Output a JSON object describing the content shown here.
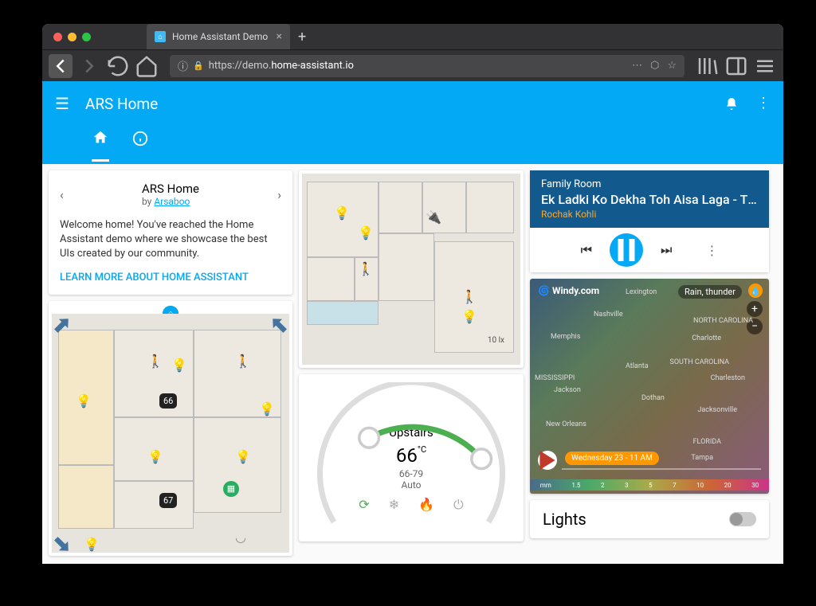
{
  "browser": {
    "tab_title": "Home Assistant Demo",
    "url_prefix": "https://",
    "url_sub": "demo.",
    "url_host": "home-assistant.io"
  },
  "header": {
    "title": "ARS Home"
  },
  "welcome": {
    "title": "ARS Home",
    "by": "by ",
    "author": "Arsaboo",
    "body": "Welcome home! You've reached the Home Assistant demo where we showcase the best UIs created by our community.",
    "link": "LEARN MORE ABOUT HOME ASSISTANT"
  },
  "floorplan1": {
    "lux_label": "10 lx",
    "badge1": "66",
    "badge2": "67"
  },
  "thermostat": {
    "name": "Upstairs",
    "value": "66",
    "unit": "°C",
    "range": "66-79",
    "mode": "Auto"
  },
  "media": {
    "room": "Family Room",
    "title": "Ek Ladki Ko Dekha Toh Aisa Laga - Title…",
    "artist": "Rochak Kohli"
  },
  "weather": {
    "logo": "Windy.com",
    "layer": "Rain, thunder",
    "timestamp": "Wednesday 23 - 11 AM",
    "cities": {
      "lexington": "Lexington",
      "nashville": "Nashville",
      "northcarolina": "NORTH CAROLINA",
      "memphis": "Memphis",
      "charlotte": "Charlotte",
      "atlanta": "Atlanta",
      "southcarolina": "SOUTH CAROLINA",
      "charleston": "Charleston",
      "mississippi": "MISSISSIPPI",
      "jackson": "Jackson",
      "dothan": "Dothan",
      "jacksonville": "Jacksonville",
      "neworleans": "New Orleans",
      "florida": "FLORIDA",
      "tampa": "Tampa"
    },
    "scale": [
      "mm",
      "1.5",
      "2",
      "3",
      "5",
      "7",
      "10",
      "20",
      "30"
    ]
  },
  "lights": {
    "title": "Lights"
  }
}
